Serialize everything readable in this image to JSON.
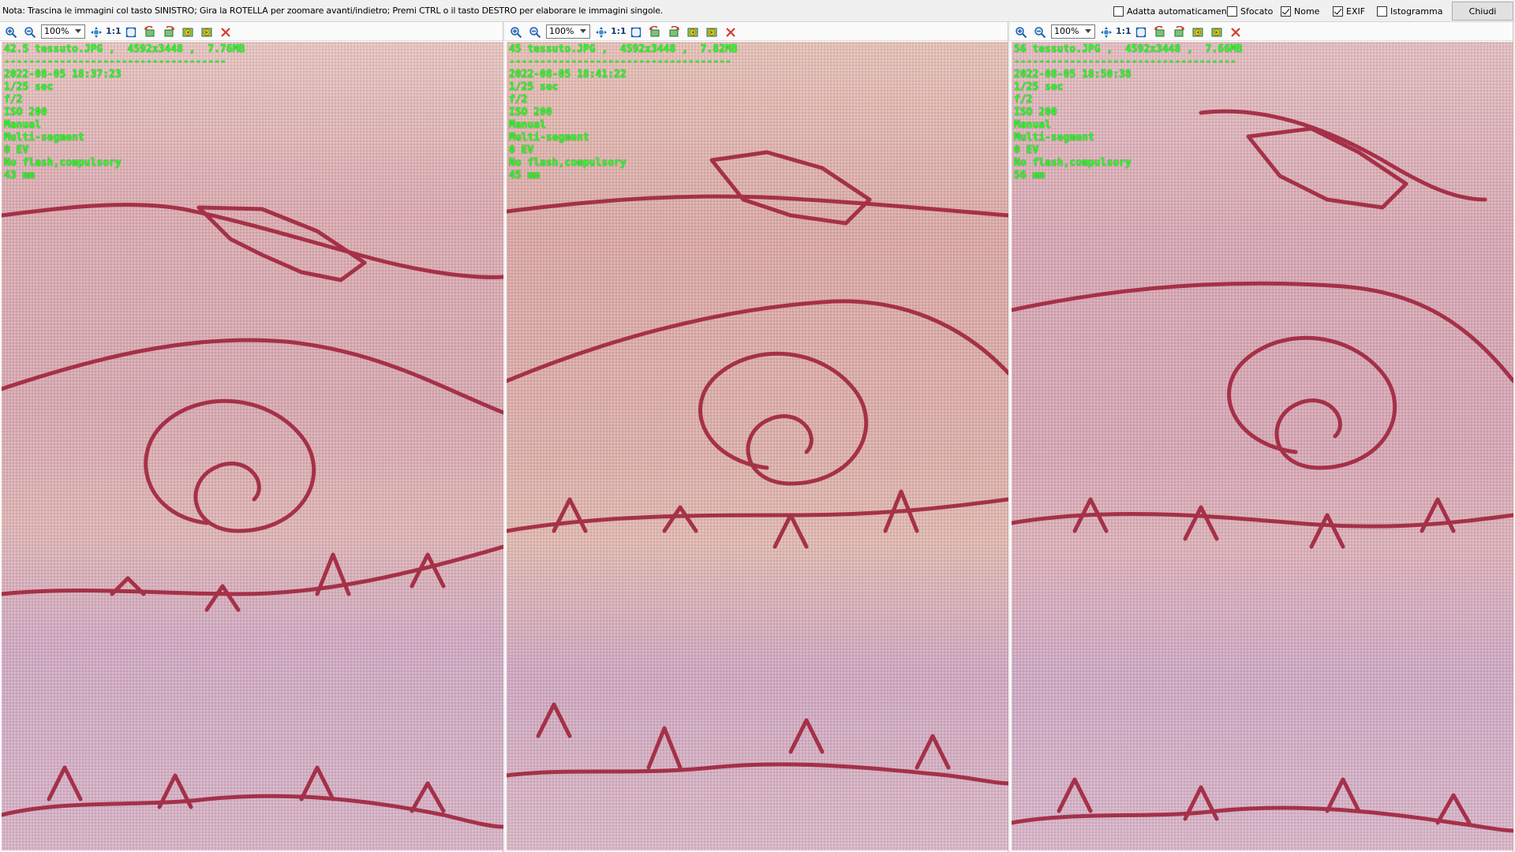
{
  "topbar": {
    "note": "Nota: Trascina le immagini col tasto SINISTRO; Gira la ROTELLA per zoomare avanti/indietro; Premi CTRL o il tasto DESTRO per elaborare le immagini singole.",
    "options": [
      {
        "label": "Adatta automaticamente",
        "checked": false
      },
      {
        "label": "Sfocato",
        "checked": false
      },
      {
        "label": "Nome",
        "checked": true
      },
      {
        "label": "EXIF",
        "checked": true
      },
      {
        "label": "Istogramma",
        "checked": false
      }
    ],
    "close_label": "Chiudi"
  },
  "toolbar": {
    "zoom_value": "100%",
    "one_to_one": "1:1",
    "icons": [
      "zoom-in-icon",
      "zoom-out-icon",
      "fit-icon",
      "actual-size-icon",
      "fit-window-icon",
      "rotate-left-icon",
      "rotate-right-icon",
      "prev-icon",
      "next-icon",
      "close-icon"
    ]
  },
  "colors": {
    "exif_text": "#22ff22",
    "thread": "#a0243c",
    "close_x": "#d93a2b"
  },
  "panels": [
    {
      "filename": "42.5 tessuto.JPG ,  4592x3448 ,  7.76MB",
      "separator": "------------------------------------",
      "datetime": "2022-08-05 18:37:23",
      "shutter": "1/25 sec",
      "aperture": "f/2",
      "iso": "ISO 200",
      "mode": "Manual",
      "metering": "Multi-segment",
      "ev": "0 EV",
      "flash": "No flash,compulsory",
      "focal": "43 mm"
    },
    {
      "filename": "45 tessuto.JPG ,  4592x3448 ,  7.82MB",
      "separator": "------------------------------------",
      "datetime": "2022-08-05 18:41:22",
      "shutter": "1/25 sec",
      "aperture": "f/2",
      "iso": "ISO 200",
      "mode": "Manual",
      "metering": "Multi-segment",
      "ev": "0 EV",
      "flash": "No flash,compulsory",
      "focal": "45 mm"
    },
    {
      "filename": "56 tessuto.JPG ,  4592x3448 ,  7.66MB",
      "separator": "------------------------------------",
      "datetime": "2022-08-05 18:50:38",
      "shutter": "1/25 sec",
      "aperture": "f/2",
      "iso": "ISO 200",
      "mode": "Manual",
      "metering": "Multi-segment",
      "ev": "0 EV",
      "flash": "No flash,compulsory",
      "focal": "56 mm"
    }
  ]
}
